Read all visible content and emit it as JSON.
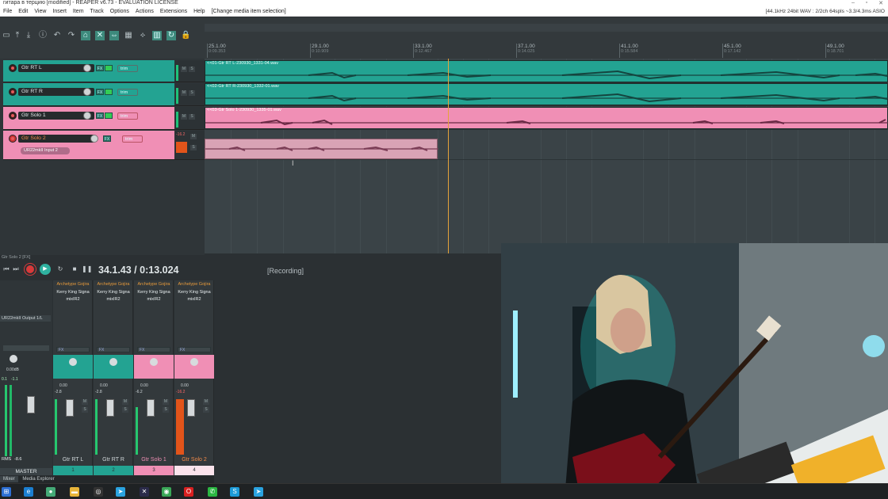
{
  "app": {
    "title": "гитара в терцию [modified] - REAPER v6.73 - EVALUATION LICENSE",
    "status_right": "[44.1kHz 24bit WAV : 2/2ch 64spls ~3.3/4.3ms ASIO",
    "status_center": "[Change media item selection]"
  },
  "menu": [
    "File",
    "Edit",
    "View",
    "Insert",
    "Item",
    "Track",
    "Options",
    "Actions",
    "Extensions",
    "Help"
  ],
  "ruler": {
    "ticks": [
      {
        "bar": "25.1.00",
        "time": "0:09.353"
      },
      {
        "bar": "29.1.00",
        "time": "0:10.909"
      },
      {
        "bar": "33.1.00",
        "time": "0:12.467"
      },
      {
        "bar": "37.1.00",
        "time": "0:14.025"
      },
      {
        "bar": "41.1.00",
        "time": "0:15.584"
      },
      {
        "bar": "45.1.00",
        "time": "0:17.142"
      },
      {
        "bar": "49.1.00",
        "time": "0:18.701"
      }
    ]
  },
  "tracks": [
    {
      "name": "Gtr RT L",
      "color": "#23a392",
      "item": "<<01-Gtr RT L-230930_1331-04.wav"
    },
    {
      "name": "Gtr RT R",
      "color": "#23a392",
      "item": "<<02-Gtr RT R-230930_1332-01.wav"
    },
    {
      "name": "Gtr Solo 1",
      "color": "#f08fb5",
      "item": "<<03-Gtr Solo 1-230930_1335-01.wav"
    },
    {
      "name": "Gtr Solo 2",
      "color": "#f08fb5",
      "item": "",
      "input": "UR22mkII Input 2",
      "meter_db": "-16.2"
    }
  ],
  "transport": {
    "position": "34.1.43 / 0:13.024",
    "state": "[Recording]",
    "selected_track_label": "Gtr Solo 2 [FX]"
  },
  "mixer": {
    "master": {
      "name": "MASTER",
      "output": "UR22mkII Output 1/L",
      "rms": "RMS",
      "peak_l": "0.1",
      "peak_r": "-1.1",
      "vol": "0.00dB",
      "val": "-8.6"
    },
    "strips": [
      {
        "name": "Gtr RT L",
        "num": "1",
        "color": "#23a392",
        "plugin1": "Archetype Gojira",
        "plugin2": "Kerry King Signa",
        "plugin3": "mixIR2",
        "vol": "0.00",
        "peak": "-2.8"
      },
      {
        "name": "Gtr RT R",
        "num": "2",
        "color": "#23a392",
        "plugin1": "Archetype Gojira",
        "plugin2": "Kerry King Signa",
        "plugin3": "mixIR2",
        "vol": "0.00",
        "peak": "-2.8"
      },
      {
        "name": "Gtr Solo 1",
        "num": "3",
        "color": "#f08fb5",
        "plugin1": "Archetype Gojira",
        "plugin2": "Kerry King Signa",
        "plugin3": "mixIR2",
        "vol": "0.00",
        "peak": "-6.2"
      },
      {
        "name": "Gtr Solo 2",
        "num": "4",
        "color": "#f08fb5",
        "plugin1": "Archetype Gojira",
        "plugin2": "Kerry King Signa",
        "plugin3": "mixIR2",
        "vol": "0.00",
        "peak": "-16.2"
      }
    ]
  },
  "bottom_tabs": [
    "Mixer",
    "Media Explorer"
  ],
  "labels": {
    "fx": "FX",
    "trim": "trim",
    "m": "M",
    "s": "S",
    "route": "Route",
    "in": "in"
  }
}
